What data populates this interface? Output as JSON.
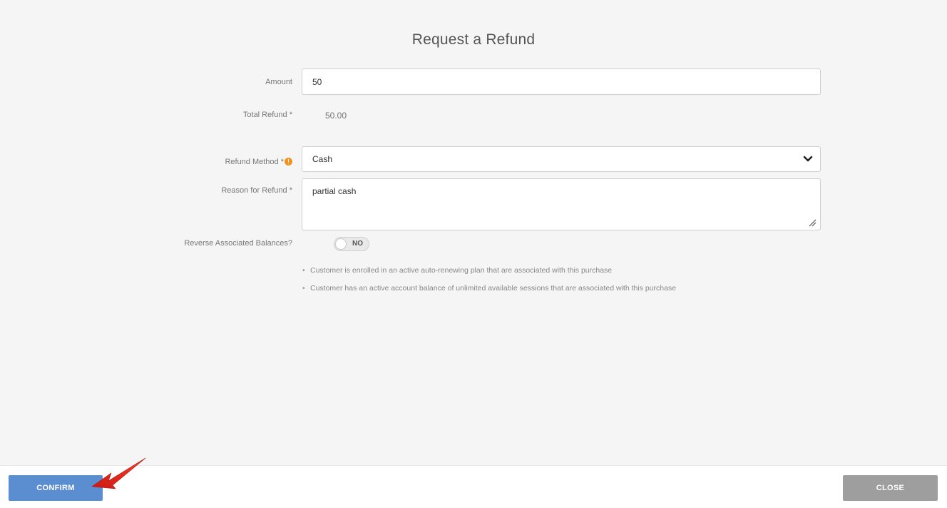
{
  "dialog": {
    "title": "Request a Refund"
  },
  "form": {
    "amount": {
      "label": "Amount",
      "value": "50"
    },
    "total_refund": {
      "label": "Total Refund *",
      "value": "50.00"
    },
    "refund_method": {
      "label": "Refund Method *",
      "info_icon": "info-icon",
      "selected": "Cash"
    },
    "reason": {
      "label": "Reason for Refund *",
      "value": "partial cash"
    },
    "reverse_balances": {
      "label": "Reverse Associated Balances?",
      "toggle_text": "NO"
    },
    "notes": [
      "Customer is enrolled in an active auto-renewing plan that are associated with this purchase",
      "Customer has an active account balance of unlimited available sessions that are associated with this purchase"
    ]
  },
  "footer": {
    "confirm_label": "CONFIRM",
    "close_label": "CLOSE"
  },
  "colors": {
    "accent": "#5b8dd1",
    "close": "#9e9e9e",
    "warning": "#f0931e",
    "annotation_arrow": "#e0261c"
  }
}
